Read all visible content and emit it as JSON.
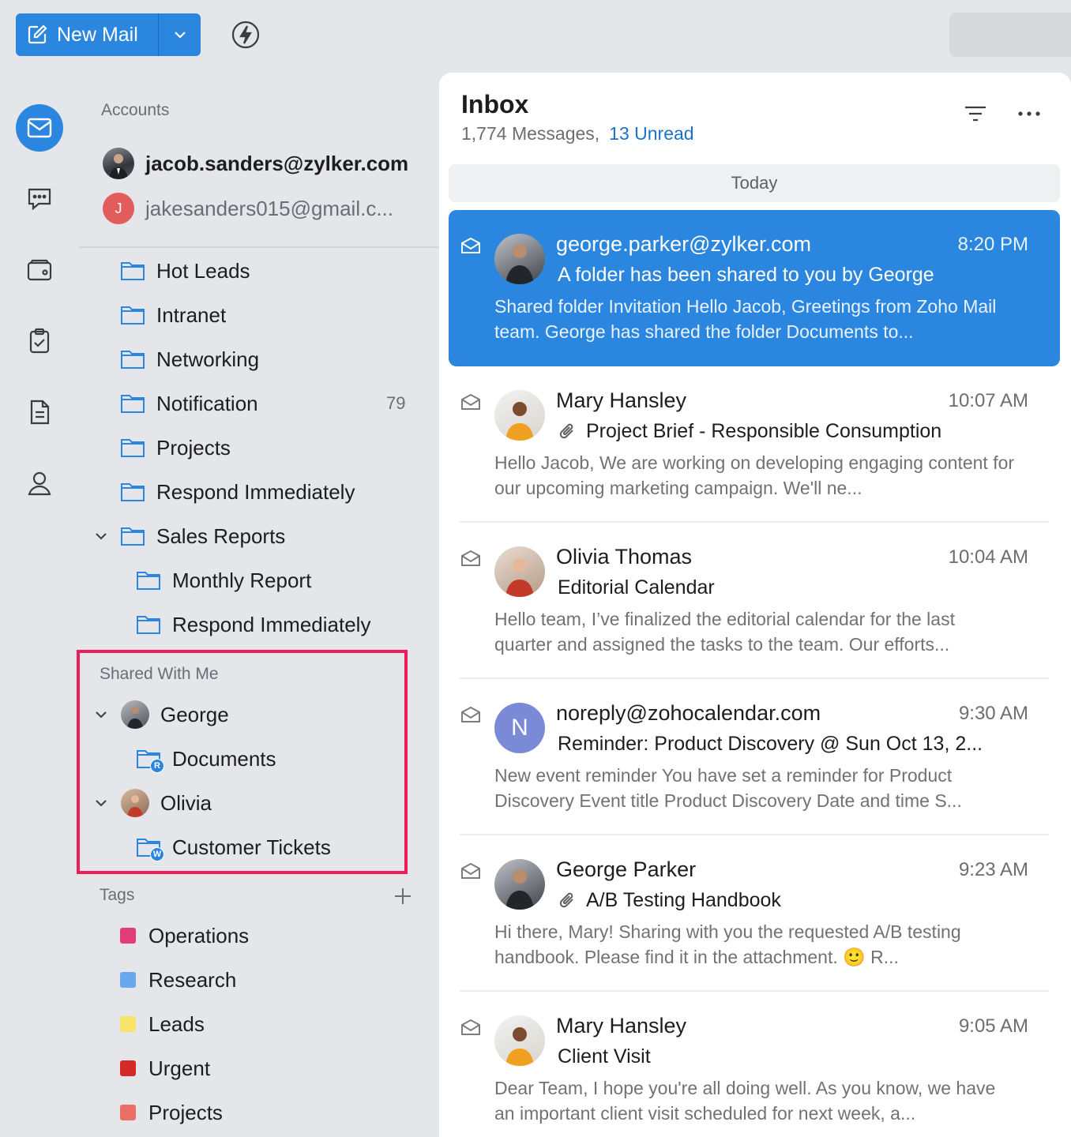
{
  "toolbar": {
    "new_mail_label": "New Mail",
    "compose_icon": "compose-icon",
    "dropdown_icon": "chevron-down-icon",
    "quick_action_icon": "lightning-bolt-icon"
  },
  "rail": [
    {
      "name": "mail-icon",
      "active": true
    },
    {
      "name": "chat-icon",
      "active": false
    },
    {
      "name": "wallet-icon",
      "active": false
    },
    {
      "name": "tasks-icon",
      "active": false
    },
    {
      "name": "notes-icon",
      "active": false
    },
    {
      "name": "contacts-icon",
      "active": false
    }
  ],
  "sidebar": {
    "accounts_label": "Accounts",
    "accounts": [
      {
        "email": "jacob.sanders@zylker.com",
        "avatar": "photo"
      },
      {
        "email": "jakesanders015@gmail.c...",
        "initial": "J"
      }
    ],
    "folders": [
      {
        "label": "Hot Leads"
      },
      {
        "label": "Intranet"
      },
      {
        "label": "Networking"
      },
      {
        "label": "Notification",
        "count": "79"
      },
      {
        "label": "Projects"
      },
      {
        "label": "Respond Immediately"
      },
      {
        "label": "Sales Reports"
      },
      {
        "label": "Monthly Report"
      },
      {
        "label": "Respond Immediately"
      }
    ],
    "shared_label": "Shared With Me",
    "shared": [
      {
        "owner": "George",
        "folder": "Documents",
        "permission": "R"
      },
      {
        "owner": "Olivia",
        "folder": "Customer Tickets",
        "permission": "W"
      }
    ],
    "tags_label": "Tags",
    "tags": [
      {
        "label": "Operations",
        "color": "#e23c78"
      },
      {
        "label": "Research",
        "color": "#6aa8ee"
      },
      {
        "label": "Leads",
        "color": "#f7e36a"
      },
      {
        "label": "Urgent",
        "color": "#d42a2a"
      },
      {
        "label": "Projects",
        "color": "#ea6f66"
      }
    ]
  },
  "inbox": {
    "title": "Inbox",
    "messages_count": "1,774 Messages,",
    "unread": "13 Unread",
    "group_label": "Today",
    "mails": [
      {
        "sender": "george.parker@zylker.com",
        "time": "8:20 PM",
        "subject": "A folder has been shared to you by George",
        "preview": "Shared folder Invitation Hello Jacob, Greetings from Zoho Mail team. George has shared the folder Documents to...",
        "attachment": false
      },
      {
        "sender": "Mary Hansley",
        "time": "10:07 AM",
        "subject": "Project Brief - Responsible Consumption",
        "preview": "Hello Jacob, We are working on developing engaging content for our upcoming marketing campaign. We'll ne...",
        "attachment": true
      },
      {
        "sender": "Olivia Thomas",
        "time": "10:04 AM",
        "subject": "Editorial Calendar",
        "preview": "Hello team, I’ve finalized the editorial calendar for the last quarter and assigned the tasks to the team. Our efforts...",
        "attachment": false
      },
      {
        "sender": "noreply@zohocalendar.com",
        "time": "9:30 AM",
        "subject": "Reminder: Product Discovery @ Sun Oct 13, 2...",
        "preview": "New event reminder You have set a reminder for Product Discovery Event title Product Discovery Date and time S...",
        "attachment": false,
        "initial": "N"
      },
      {
        "sender": "George Parker",
        "time": "9:23 AM",
        "subject": "A/B Testing Handbook",
        "preview": "Hi there, Mary! Sharing with you the requested A/B testing handbook. Please find it in the attachment. 🙂 R...",
        "attachment": true
      },
      {
        "sender": "Mary Hansley",
        "time": "9:05 AM",
        "subject": "Client Visit",
        "preview": "Dear Team, I hope you're all doing well. As you know, we have an important client visit scheduled for next week, a...",
        "attachment": false
      }
    ]
  },
  "colors": {
    "accent": "#2a86de",
    "highlight_box": "#ee1c5c",
    "unread_link": "#1a73c9"
  }
}
